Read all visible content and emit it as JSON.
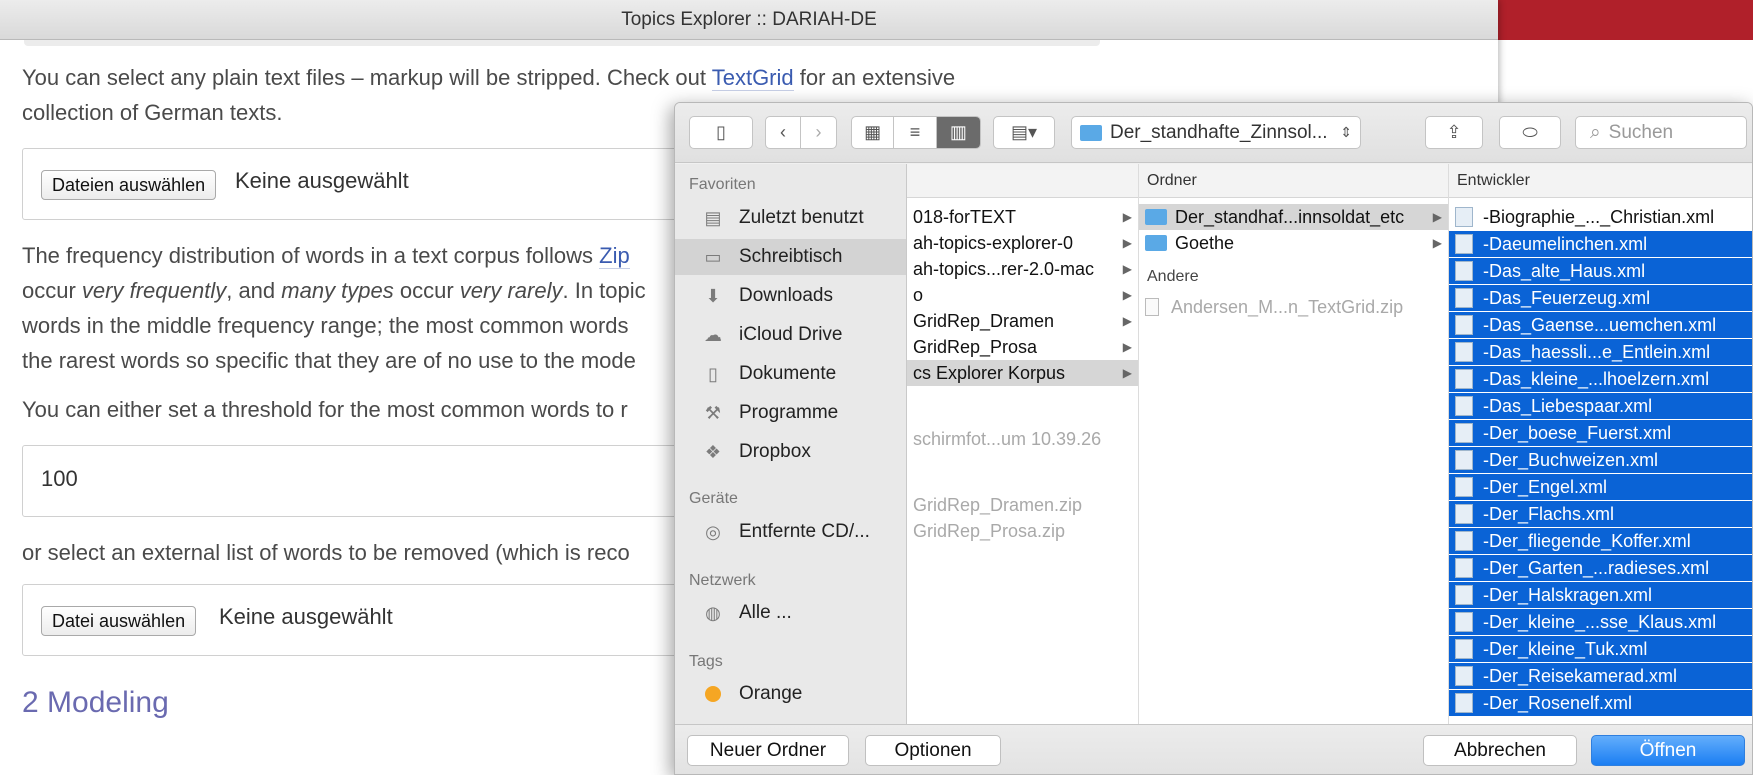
{
  "window": {
    "title": "Topics Explorer :: DARIAH-DE"
  },
  "page": {
    "para1_pre": "You can select any plain text files – markup will be stripped. Check out ",
    "para1_link": "TextGrid",
    "para1_post": " for an extensive",
    "para1_line2": "collection of German texts.",
    "file_button": "Dateien auswählen",
    "file_status": "Keine ausgewählt",
    "para2_pre": "The frequency distribution of words in a text corpus follows ",
    "para2_link": "Zip",
    "para2_l2_a": "occur ",
    "para2_l2_em1": "very frequently",
    "para2_l2_b": ", and ",
    "para2_l2_em2": "many types",
    "para2_l2_c": " occur ",
    "para2_l2_em3": "very rarely",
    "para2_l2_d": ". In topic",
    "para2_line3": "words in the middle frequency range; the most common words",
    "para2_line4": "the rarest words so specific that they are of no use to the mode",
    "para3": "You can either set a threshold for the most common words to r",
    "threshold_value": "100",
    "para4": "or select an external list of words to be removed (which is reco",
    "stopword_button": "Datei auswählen",
    "stopword_status": "Keine ausgewählt",
    "section_title": "2 Modeling"
  },
  "dialog": {
    "path": "Der_standhafte_Zinnsol...",
    "search_placeholder": "Suchen",
    "sidebar": {
      "favorites_title": "Favoriten",
      "favorites": [
        {
          "label": "Zuletzt benutzt",
          "icon": "recents-icon"
        },
        {
          "label": "Schreibtisch",
          "icon": "desktop-icon"
        },
        {
          "label": "Downloads",
          "icon": "downloads-icon"
        },
        {
          "label": "iCloud Drive",
          "icon": "cloud-icon"
        },
        {
          "label": "Dokumente",
          "icon": "documents-icon"
        },
        {
          "label": "Programme",
          "icon": "applications-icon"
        },
        {
          "label": "Dropbox",
          "icon": "dropbox-icon"
        }
      ],
      "devices_title": "Geräte",
      "devices": [
        {
          "label": "Entfernte CD/...",
          "icon": "disc-icon"
        }
      ],
      "network_title": "Netzwerk",
      "network": [
        {
          "label": "Alle ...",
          "icon": "globe-icon"
        }
      ],
      "tags_title": "Tags",
      "tags": [
        {
          "label": "Orange",
          "color": "#f5a623"
        }
      ]
    },
    "col1": {
      "items": [
        "018-forTEXT",
        "ah-topics-explorer-0",
        "ah-topics...rer-2.0-mac",
        "o",
        "GridRep_Dramen",
        "GridRep_Prosa",
        "cs Explorer Korpus"
      ],
      "dim_items": [
        "schirmfot...um 10.39.26",
        "GridRep_Dramen.zip",
        "GridRep_Prosa.zip"
      ]
    },
    "col2": {
      "header": "Ordner",
      "folders": [
        "Der_standhaf...innsoldat_etc",
        "Goethe"
      ],
      "other_title": "Andere",
      "other": [
        "Andersen_M...n_TextGrid.zip"
      ]
    },
    "col3": {
      "header": "Entwickler",
      "first": "-Biographie_..._Christian.xml",
      "files": [
        "-Daeumelinchen.xml",
        "-Das_alte_Haus.xml",
        "-Das_Feuerzeug.xml",
        "-Das_Gaense...uemchen.xml",
        "-Das_haessli...e_Entlein.xml",
        "-Das_kleine_...lhoelzern.xml",
        "-Das_Liebespaar.xml",
        "-Der_boese_Fuerst.xml",
        "-Der_Buchweizen.xml",
        "-Der_Engel.xml",
        "-Der_Flachs.xml",
        "-Der_fliegende_Koffer.xml",
        "-Der_Garten_...radieses.xml",
        "-Der_Halskragen.xml",
        "-Der_kleine_...sse_Klaus.xml",
        "-Der_kleine_Tuk.xml",
        "-Der_Reisekamerad.xml",
        "-Der_Rosenelf.xml"
      ]
    },
    "footer": {
      "new_folder": "Neuer Ordner",
      "options": "Optionen",
      "cancel": "Abbrechen",
      "open": "Öffnen"
    }
  }
}
